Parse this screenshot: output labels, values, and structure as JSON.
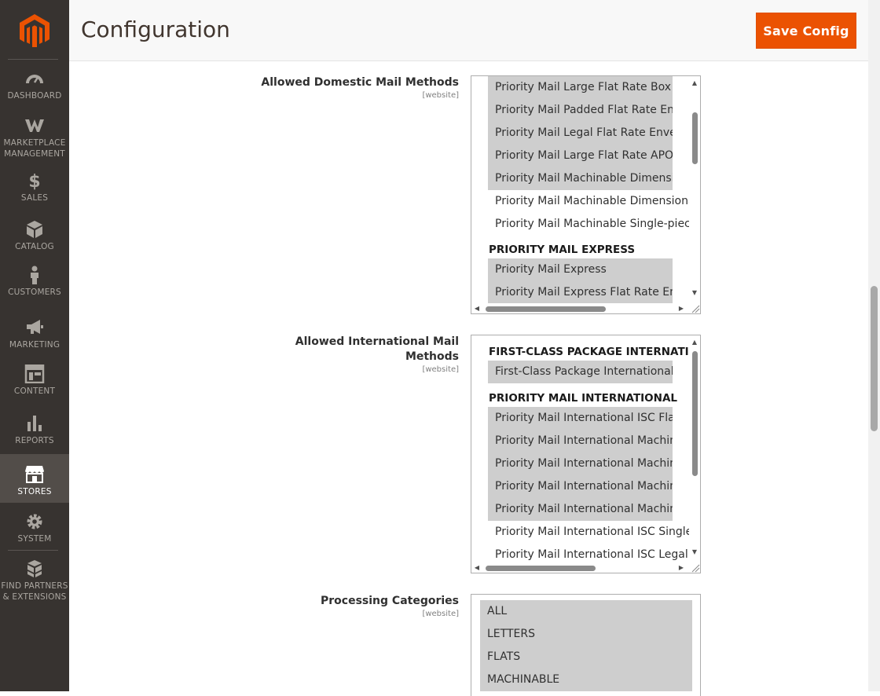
{
  "sidebar": {
    "items": [
      {
        "label": "DASHBOARD",
        "icon": "dashboard-icon"
      },
      {
        "label": "MARKETPLACE\nMANAGEMENT",
        "icon": "marketplace-icon"
      },
      {
        "label": "SALES",
        "icon": "dollar-icon"
      },
      {
        "label": "CATALOG",
        "icon": "box-icon"
      },
      {
        "label": "CUSTOMERS",
        "icon": "person-icon"
      },
      {
        "label": "MARKETING",
        "icon": "megaphone-icon"
      },
      {
        "label": "CONTENT",
        "icon": "layout-icon"
      },
      {
        "label": "REPORTS",
        "icon": "bar-chart-icon"
      },
      {
        "label": "STORES",
        "icon": "storefront-icon"
      },
      {
        "label": "SYSTEM",
        "icon": "gear-icon"
      },
      {
        "label": "FIND PARTNERS\n& EXTENSIONS",
        "icon": "blocks-icon"
      }
    ],
    "active": "STORES",
    "colors": {
      "background": "#373330",
      "active": "#524d49",
      "logo": "#eb5202"
    }
  },
  "header": {
    "title": "Configuration",
    "save_label": "Save Config",
    "accent": "#eb5202"
  },
  "fields": {
    "domestic": {
      "label": "Allowed Domestic Mail Methods",
      "scope": "[website]",
      "options": [
        {
          "text": "Priority Mail Large Flat Rate Box",
          "selected": true
        },
        {
          "text": "Priority Mail Padded Flat Rate Envelope",
          "selected": true
        },
        {
          "text": "Priority Mail Legal Flat Rate Envelope",
          "selected": true
        },
        {
          "text": "Priority Mail Large Flat Rate APO/FPO",
          "selected": true
        },
        {
          "text": "Priority Mail Machinable Dimensional",
          "selected": true
        },
        {
          "text": "Priority Mail Machinable Dimensional",
          "selected": false
        },
        {
          "text": "Priority Mail Machinable Single-piece",
          "selected": false
        }
      ],
      "group2": "PRIORITY MAIL EXPRESS",
      "options2": [
        {
          "text": "Priority Mail Express",
          "selected": true
        },
        {
          "text": "Priority Mail Express Flat Rate Envelope",
          "selected": true
        }
      ]
    },
    "international": {
      "label": "Allowed International Mail Methods",
      "scope": "[website]",
      "group1": "FIRST-CLASS PACKAGE INTERNATIONAL",
      "options1": [
        {
          "text": "First-Class Package International Service",
          "selected": true
        }
      ],
      "group2": "PRIORITY MAIL INTERNATIONAL",
      "options2": [
        {
          "text": "Priority Mail International ISC Flat Rate",
          "selected": true
        },
        {
          "text": "Priority Mail International Machinable",
          "selected": true
        },
        {
          "text": "Priority Mail International Machinable",
          "selected": true
        },
        {
          "text": "Priority Mail International Machinable",
          "selected": true
        },
        {
          "text": "Priority Mail International Machinable",
          "selected": true
        },
        {
          "text": "Priority Mail International ISC Single-piece",
          "selected": false
        },
        {
          "text": "Priority Mail International ISC Legal Flat",
          "selected": false
        }
      ]
    },
    "categories": {
      "label": "Processing Categories",
      "scope": "[website]",
      "options": [
        {
          "text": "ALL",
          "selected": true
        },
        {
          "text": "LETTERS",
          "selected": true
        },
        {
          "text": "FLATS",
          "selected": true
        },
        {
          "text": "MACHINABLE",
          "selected": true
        }
      ]
    }
  }
}
